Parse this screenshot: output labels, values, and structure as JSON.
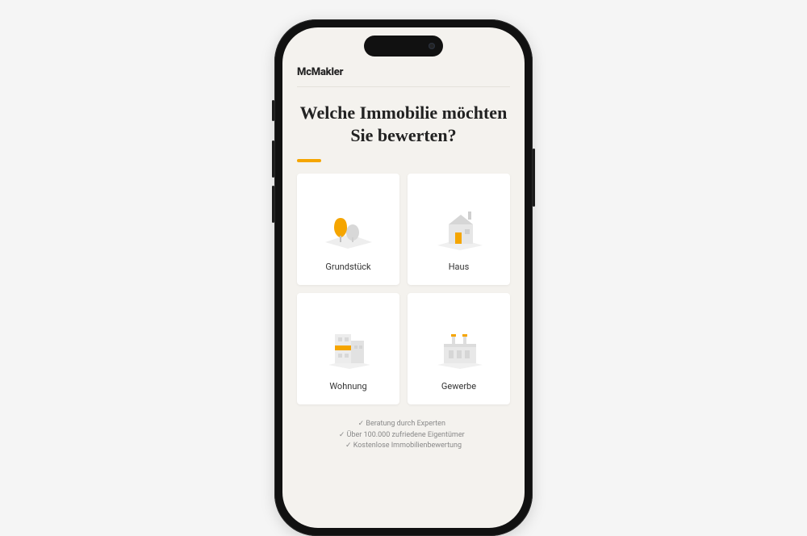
{
  "brand": "McMakler",
  "headline": "Welche Immobilie möchten Sie bewerten?",
  "options": [
    {
      "label": "Grundstück"
    },
    {
      "label": "Haus"
    },
    {
      "label": "Wohnung"
    },
    {
      "label": "Gewerbe"
    }
  ],
  "footer": {
    "item1": "✓ Beratung durch Experten",
    "item2": "✓ Über 100.000 zufriedene Eigentümer",
    "item3": "✓ Kostenlose Immobilienbewertung"
  },
  "accent": "#f5a500"
}
